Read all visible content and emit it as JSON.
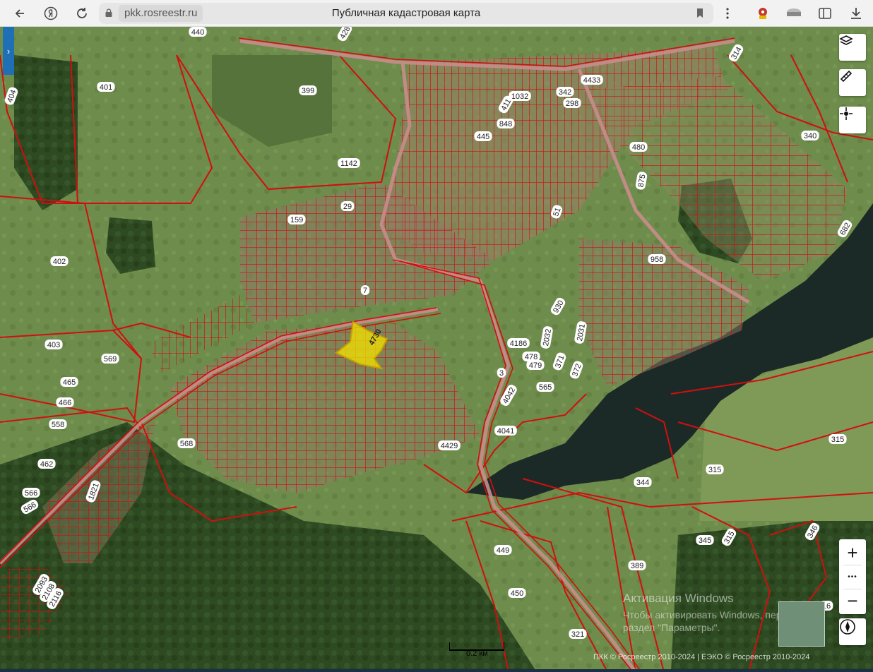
{
  "browser": {
    "url_domain": "pkk.rosreestr.ru",
    "page_title": "Публичная кадастровая карта",
    "icons": [
      "back-icon",
      "yandex-icon",
      "reload-icon",
      "lock-icon",
      "bookmark-icon",
      "menu-dots-icon",
      "extension-icon",
      "extension2-icon",
      "sidebar-icon",
      "download-icon"
    ]
  },
  "map": {
    "sidebar_toggle": "›",
    "controls": [
      "layers-icon",
      "ruler-icon",
      "locate-icon"
    ],
    "zoom": {
      "plus": "+",
      "more": "•••",
      "minus": "−"
    },
    "compass": "compass-icon",
    "scale_label": "0.2 км",
    "copyright": "ПКК © Росреестр 2010-2024 | ЕЭКО © Росреестр 2010-2024",
    "watermark": {
      "title": "Активация Windows",
      "text": "Чтобы активировать Windows, перейдите в раздел \"Параметры\"."
    },
    "highlight_parcel": "4730",
    "parcel_labels": [
      "440",
      "428",
      "314",
      "401",
      "404",
      "399",
      "4433",
      "1032",
      "342",
      "298",
      "340",
      "480",
      "875",
      "1142",
      "29",
      "159",
      "51",
      "682",
      "402",
      "958",
      "7",
      "930",
      "2031",
      "2032",
      "4186",
      "478",
      "479",
      "371",
      "372",
      "403",
      "569",
      "3",
      "565",
      "4042",
      "465",
      "466",
      "558",
      "568",
      "4041",
      "4429",
      "315",
      "462",
      "315",
      "344",
      "566",
      "566",
      "1821",
      "345",
      "315",
      "346",
      "449",
      "389",
      "2093",
      "2108",
      "2116",
      "450",
      "16",
      "321",
      "848",
      "445",
      "411"
    ],
    "colors": {
      "parcel_border": "#d10f0f",
      "highlight_fill": "#f4e300",
      "river": "#1c2a27",
      "sidebar_toggle": "#1f6fb5"
    }
  }
}
